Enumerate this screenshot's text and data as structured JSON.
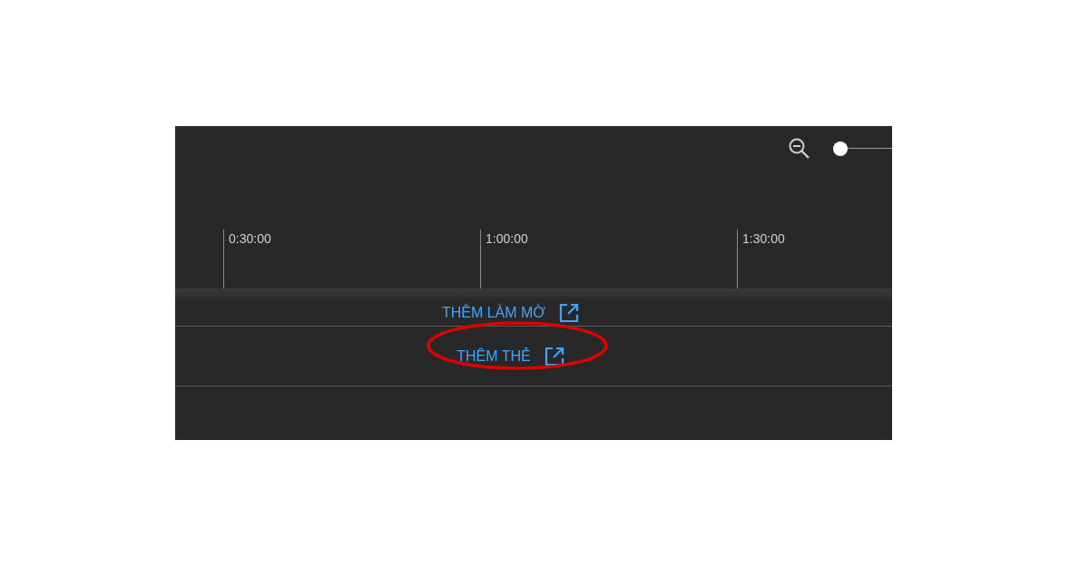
{
  "zoom_slider": {
    "level": 0
  },
  "timeline": {
    "ticks": [
      {
        "label": "0:30:00"
      },
      {
        "label": "1:00:00"
      },
      {
        "label": "1:30:00"
      }
    ]
  },
  "tracks": [
    {
      "label": "THÊM LÀM MỜ",
      "highlighted": false
    },
    {
      "label": "THÊM THẺ",
      "highlighted": true
    }
  ]
}
